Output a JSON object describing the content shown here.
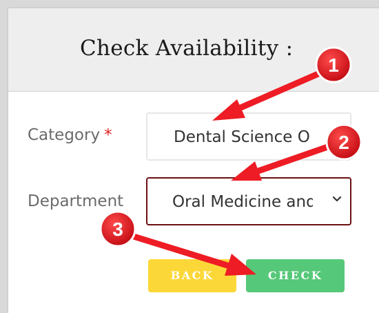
{
  "title": "Check Availability :",
  "form": {
    "category": {
      "label": "Category",
      "required_mark": "*",
      "value": "Dental Science O"
    },
    "department": {
      "label": "Department",
      "value": "Oral Medicine and"
    }
  },
  "buttons": {
    "back": "BACK",
    "check": "CHECK"
  },
  "annotations": {
    "markers": [
      "1",
      "2",
      "3"
    ],
    "color": "#ee1c24"
  },
  "colors": {
    "back_button": "#fcd738",
    "check_button": "#56c879",
    "select_border": "#6b0f12",
    "required": "#e02020"
  },
  "icons": {
    "select_caret": "chevron-down-icon"
  }
}
